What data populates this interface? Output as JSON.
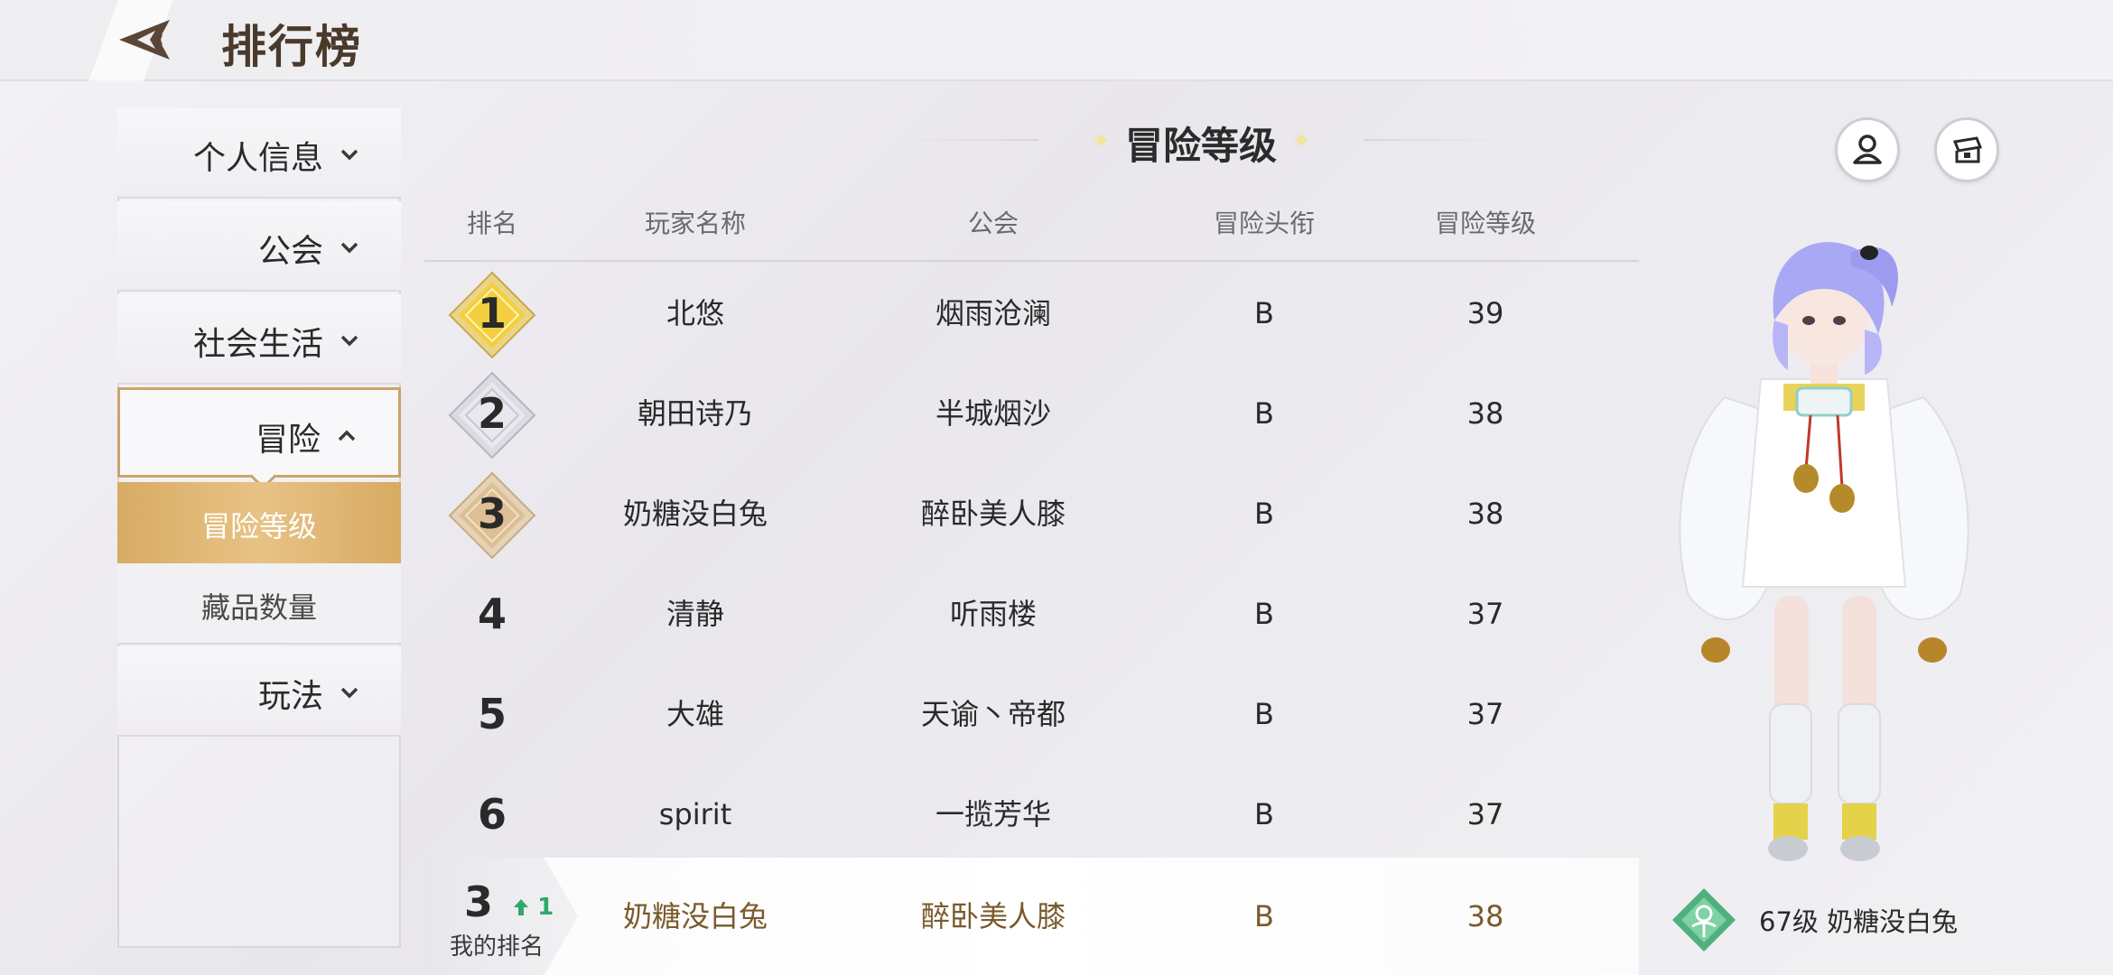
{
  "header": {
    "title": "排行榜"
  },
  "sidebar": {
    "items": [
      {
        "label": "个人信息",
        "expanded": false
      },
      {
        "label": "公会",
        "expanded": false
      },
      {
        "label": "社会生活",
        "expanded": false
      },
      {
        "label": "冒险",
        "expanded": true,
        "sub_items": [
          {
            "label": "冒险等级",
            "selected": true
          },
          {
            "label": "藏品数量",
            "selected": false
          }
        ]
      },
      {
        "label": "玩法",
        "expanded": false
      }
    ]
  },
  "board": {
    "title": "冒险等级",
    "columns": [
      "排名",
      "玩家名称",
      "公会",
      "冒险头衔",
      "冒险等级"
    ],
    "rows": [
      {
        "rank": "1",
        "name": "北悠",
        "guild": "烟雨沧澜",
        "title": "B",
        "level": "39",
        "medal": "gold"
      },
      {
        "rank": "2",
        "name": "朝田诗乃",
        "guild": "半城烟沙",
        "title": "B",
        "level": "38",
        "medal": "silver"
      },
      {
        "rank": "3",
        "name": "奶糖没白兔",
        "guild": "醉卧美人膝",
        "title": "B",
        "level": "38",
        "medal": "bronze"
      },
      {
        "rank": "4",
        "name": "清静",
        "guild": "听雨楼",
        "title": "B",
        "level": "37"
      },
      {
        "rank": "5",
        "name": "大雄",
        "guild": "天谕丶帝都",
        "title": "B",
        "level": "37"
      },
      {
        "rank": "6",
        "name": "spirit",
        "guild": "一揽芳华",
        "title": "B",
        "level": "37"
      }
    ],
    "my_rank": {
      "rank": "3",
      "change": "1",
      "label": "我的排名",
      "name": "奶糖没白兔",
      "guild": "醉卧美人膝",
      "title": "B",
      "level": "38"
    }
  },
  "profile": {
    "text": "67级 奶糖没白兔"
  },
  "icons": {
    "profile_button": "person-icon",
    "chest_button": "treasure-chest-icon"
  },
  "colors": {
    "accent_gold": "#d7ab63",
    "rank_up_green": "#2fa86a",
    "my_row_text": "#7a5a2c"
  }
}
